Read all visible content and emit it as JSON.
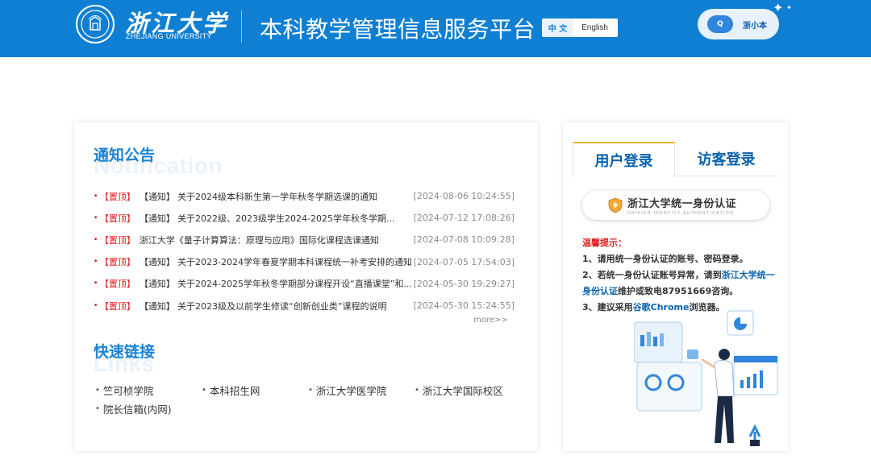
{
  "header": {
    "logo_cn": "浙江大学",
    "logo_en": "ZHEJIANG UNIVERSITY",
    "platform_title": "本科教学管理信息服务平台",
    "lang_cn": "中 文",
    "lang_en": "English",
    "assistant_label": "浙小本",
    "assistant_icon_text": "Q"
  },
  "colors": {
    "brand_blue": "#0f7fd3",
    "title_blue": "#1a83d4",
    "pin_red": "#e02020",
    "tab_accent": "#f5b323"
  },
  "notices": {
    "title": "通知公告",
    "ghost": "Notification",
    "more": "more>>",
    "items": [
      {
        "pin": "【置顶】",
        "tag": "【通知】",
        "title": "关于2024级本科新生第一学年秋冬学期选课的通知",
        "date": "[2024-08-06 10:24:55]"
      },
      {
        "pin": "【置顶】",
        "tag": "【通知】",
        "title": "关于2022级、2023级学生2024-2025学年秋冬学期...",
        "date": "[2024-07-12 17:08:26]"
      },
      {
        "pin": "【置顶】",
        "tag": "",
        "title": "浙江大学《量子计算算法：原理与应用》国际化课程选课通知",
        "date": "[2024-07-08 10:09:28]"
      },
      {
        "pin": "【置顶】",
        "tag": "【通知】",
        "title": "关于2023-2024学年春夏学期本科课程统一补考安排的通知",
        "date": "[2024-07-05 17:54:03]"
      },
      {
        "pin": "【置顶】",
        "tag": "【通知】",
        "title": "关于2024-2025学年秋冬学期部分课程开设“直播课堂”和...",
        "date": "[2024-05-30 19:29:27]"
      },
      {
        "pin": "【置顶】",
        "tag": "【通知】",
        "title": "关于2023级及以前学生修读“创新创业类”课程的说明",
        "date": "[2024-05-30 15:24:55]"
      }
    ]
  },
  "links": {
    "title": "快速链接",
    "ghost": "Links",
    "items": [
      "竺可桢学院",
      "本科招生网",
      "浙江大学医学院",
      "浙江大学国际校区",
      "院长信箱(内网)"
    ]
  },
  "login": {
    "tab_user": "用户登录",
    "tab_guest": "访客登录",
    "auth_cn": "浙江大学统一身份认证",
    "auth_en": "UNIFIED IDENTITY AUTHENTICATION",
    "tips_title": "温馨提示：",
    "tip1": "1、请用统一身份认证的账号、密码登录。",
    "tip2_a": "2、若统一身份认证账号异常，请到",
    "tip2_link": "浙江大学统一身份认证",
    "tip2_b": "维护或致电87951669咨询。",
    "tip3_a": "3、建议采用",
    "tip3_link": "谷歌Chrome",
    "tip3_b": "浏览器。"
  }
}
